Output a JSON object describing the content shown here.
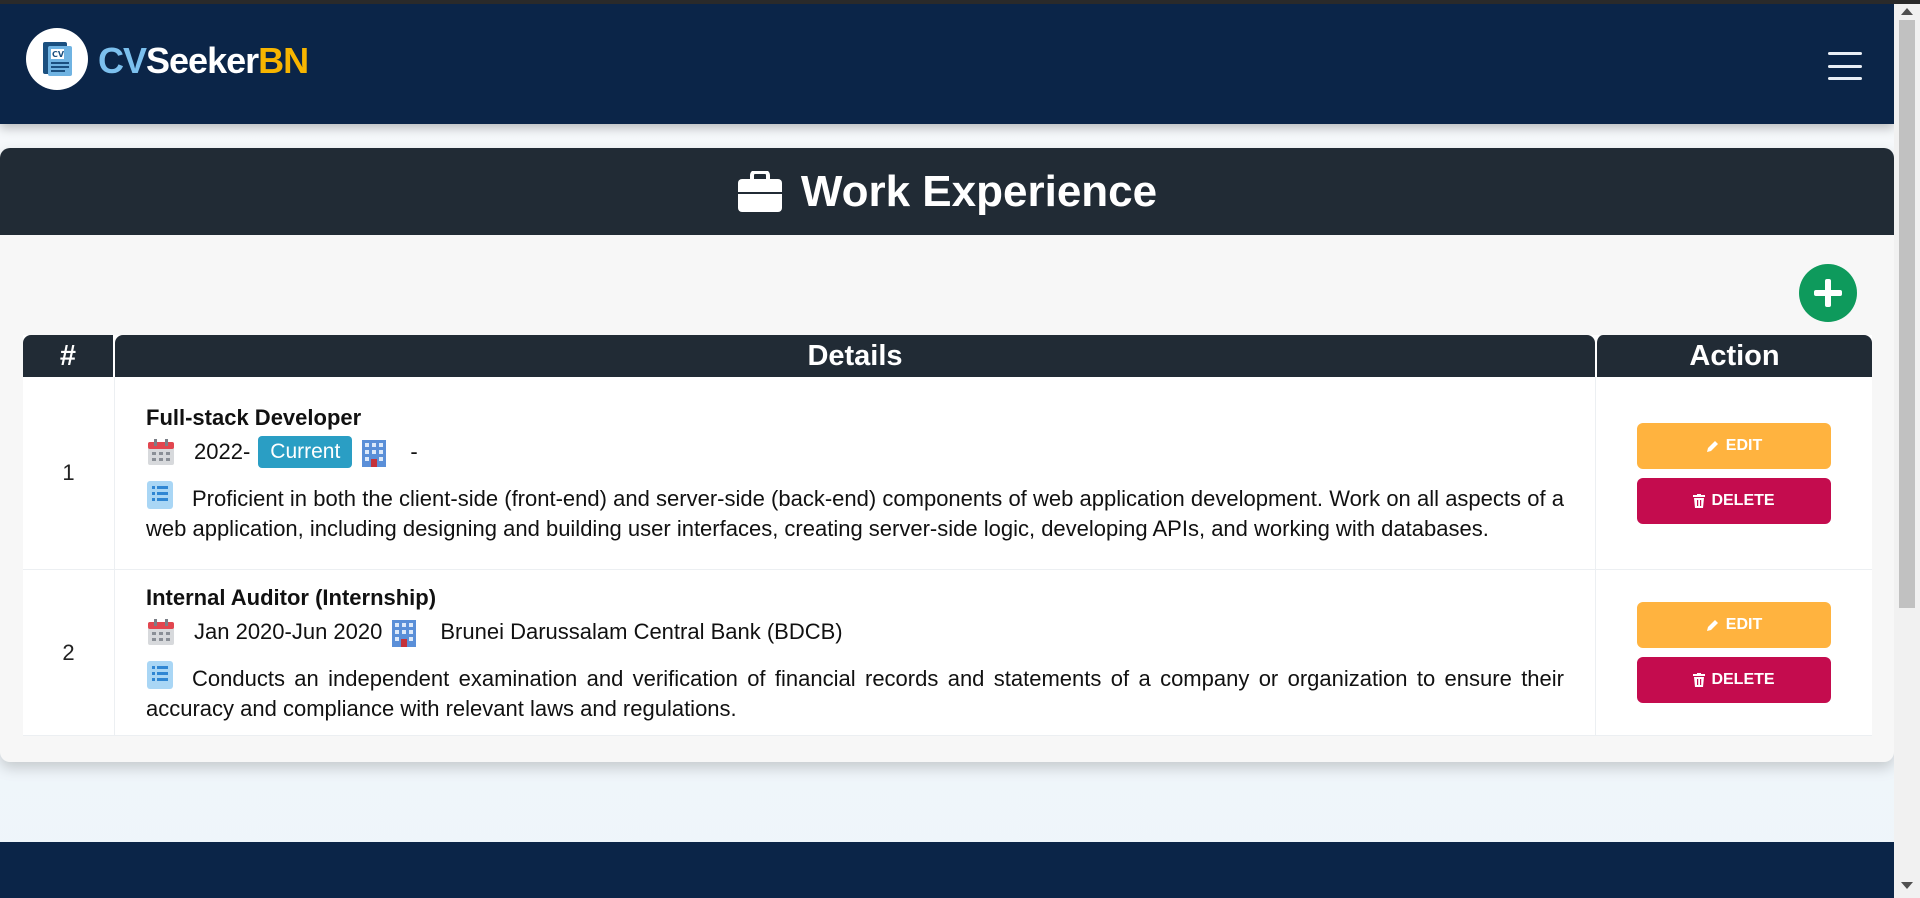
{
  "navbar": {
    "brand_part1": "CV",
    "brand_part2": "Seeker",
    "brand_part3": "BN",
    "logo_text": "CV"
  },
  "page": {
    "title": "Work Experience"
  },
  "table": {
    "headers": [
      "#",
      "Details",
      "Action"
    ],
    "rows": [
      {
        "num": "1",
        "title": "Full-stack Developer",
        "date": "2022-",
        "badge": "Current",
        "company": "-",
        "description": "Proficient in both the client-side (front-end) and server-side (back-end) components of web application development. Work on all aspects of a web application, including designing and building user interfaces, creating server-side logic, developing APIs, and working with databases.",
        "edit_label": "EDIT",
        "delete_label": "DELETE"
      },
      {
        "num": "2",
        "title": "Internal Auditor (Internship)",
        "date": "Jan 2020-Jun 2020",
        "company": "Brunei Darussalam Central Bank (BDCB)",
        "description": "Conducts an independent examination and verification of financial records and statements of a company or organization to ensure their accuracy and compliance with relevant laws and regulations.",
        "edit_label": "EDIT",
        "delete_label": "DELETE"
      }
    ]
  },
  "colors": {
    "navbar": "#0b2548",
    "header": "#212b35",
    "add": "#0e9a5c",
    "edit": "#ffb33f",
    "delete": "#c40c4e",
    "badge": "#2a9ec4"
  },
  "icons": [
    "cv-logo-icon",
    "hamburger-menu-icon",
    "briefcase-icon",
    "plus-icon",
    "calendar-icon",
    "building-icon",
    "list-icon",
    "pencil-icon",
    "trash-icon"
  ]
}
